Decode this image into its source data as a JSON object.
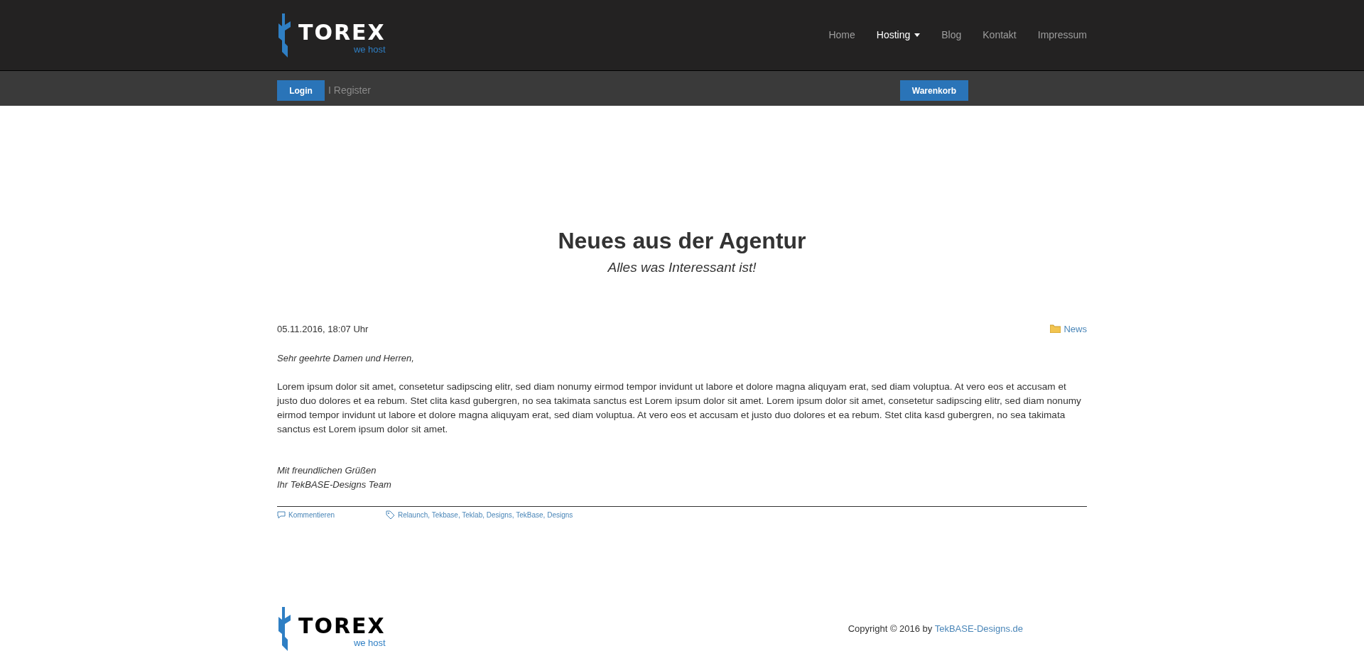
{
  "header": {
    "logo": {
      "name": "TOREX",
      "tagline": "we host"
    },
    "nav": [
      {
        "label": "Home",
        "selected": false,
        "dropdown": false
      },
      {
        "label": "Hosting",
        "selected": true,
        "dropdown": true
      },
      {
        "label": "Blog",
        "selected": false,
        "dropdown": false
      },
      {
        "label": "Kontakt",
        "selected": false,
        "dropdown": false
      },
      {
        "label": "Impressum",
        "selected": false,
        "dropdown": false
      }
    ]
  },
  "account_bar": {
    "login": "Login",
    "register": "I Register",
    "cart": "Warenkorb"
  },
  "page": {
    "title": "Neues aus der Agentur",
    "subtitle": "Alles was Interessant ist!"
  },
  "post": {
    "date": "05.11.2016, 18:07 Uhr",
    "category": "News",
    "greeting": "Sehr geehrte Damen und Herren,",
    "body": "Lorem ipsum dolor sit amet, consetetur sadipscing elitr, sed diam nonumy eirmod tempor invidunt ut labore et dolore magna aliquyam erat, sed diam voluptua. At vero eos et accusam et justo duo dolores et ea rebum. Stet clita kasd gubergren, no sea takimata sanctus est Lorem ipsum dolor sit amet. Lorem ipsum dolor sit amet, consetetur sadipscing elitr, sed diam nonumy eirmod tempor invidunt ut labore et dolore magna aliquyam erat, sed diam voluptua. At vero eos et accusam et justo duo dolores et ea rebum. Stet clita kasd gubergren, no sea takimata sanctus est Lorem ipsum dolor sit amet.",
    "closing": [
      "Mit freundlichen Grüßen",
      "Ihr TekBASE-Designs Team"
    ],
    "comments": "Kommentieren",
    "tags": "Relaunch, Tekbase, Teklab, Designs, TekBase, Designs"
  },
  "footer": {
    "logo": {
      "name": "TOREX",
      "tagline": "we host"
    },
    "copyright": "Copyright © 2016 by",
    "link": "TekBASE-Designs.de"
  }
}
